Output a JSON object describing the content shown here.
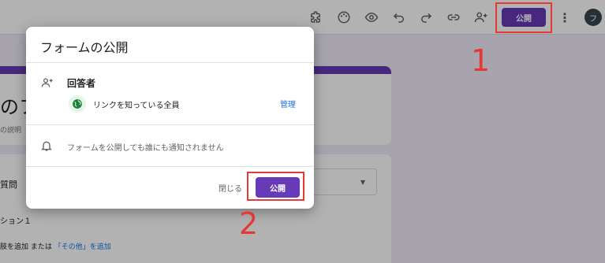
{
  "toolbar": {
    "icons": [
      "puzzle-icon",
      "palette-icon",
      "eye-icon",
      "undo-icon",
      "redo-icon",
      "link-icon",
      "add-person-icon"
    ],
    "publish_label": "公開",
    "more_label": "⋮",
    "avatar_initial": "フ"
  },
  "form": {
    "title_fragment": "のフ",
    "description_fragment": "の説明",
    "question_fragment": "質問",
    "option_fragment": "ション１",
    "add_prefix": "肢を追加",
    "add_or": "または",
    "add_other": "「その他」を追加"
  },
  "dialog": {
    "title": "フォームの公開",
    "responders_label": "回答者",
    "link_access": "リンクを知っている全員",
    "manage_label": "管理",
    "notify_text": "フォームを公開しても誰にも通知されません",
    "close_label": "閉じる",
    "publish_label": "公開"
  },
  "annotations": {
    "step1": "1",
    "step2": "2",
    "color": "#e53935"
  },
  "colors": {
    "accent": "#673ab7",
    "link": "#1a73e8",
    "background": "#f0ebf8"
  }
}
